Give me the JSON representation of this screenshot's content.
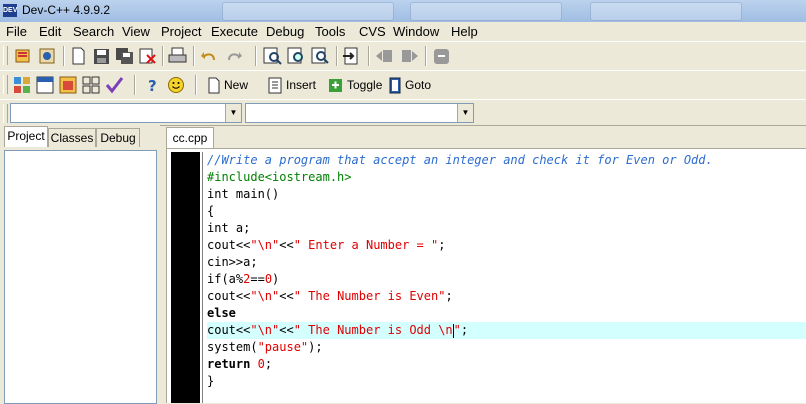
{
  "window": {
    "title": "Dev-C++ 4.9.9.2"
  },
  "menu": [
    "File",
    "Edit",
    "Search",
    "View",
    "Project",
    "Execute",
    "Debug",
    "Tools",
    "CVS",
    "Window",
    "Help"
  ],
  "toolbar2": {
    "new_label": "New",
    "insert_label": "Insert",
    "toggle_label": "Toggle",
    "goto_label": "Goto"
  },
  "combos": {
    "left_value": "",
    "right_value": ""
  },
  "left_panel": {
    "tabs": [
      "Project",
      "Classes",
      "Debug"
    ],
    "active_tab": "Project"
  },
  "editor": {
    "tab_label": "cc.cpp",
    "highlighted_line": 10,
    "lines": [
      [
        {
          "t": "//Write a program that accept an integer and check it for Even or Odd.",
          "c": "comment"
        }
      ],
      [
        {
          "t": "#include<iostream.h>",
          "c": "pre"
        }
      ],
      [
        {
          "t": "int main()",
          "c": ""
        }
      ],
      [
        {
          "t": "{",
          "c": ""
        }
      ],
      [
        {
          "t": "int a;",
          "c": ""
        }
      ],
      [
        {
          "t": "cout<<",
          "c": ""
        },
        {
          "t": "\"\\n\"",
          "c": "str"
        },
        {
          "t": "<<",
          "c": ""
        },
        {
          "t": "\" Enter a Number = \"",
          "c": "str"
        },
        {
          "t": ";",
          "c": ""
        }
      ],
      [
        {
          "t": "cin>>a;",
          "c": ""
        }
      ],
      [
        {
          "t": "if(a%",
          "c": ""
        },
        {
          "t": "2",
          "c": "num"
        },
        {
          "t": "==",
          "c": ""
        },
        {
          "t": "0",
          "c": "num"
        },
        {
          "t": ")",
          "c": ""
        }
      ],
      [
        {
          "t": "cout<<",
          "c": ""
        },
        {
          "t": "\"\\n\"",
          "c": "str"
        },
        {
          "t": "<<",
          "c": ""
        },
        {
          "t": "\" The Number is Even\"",
          "c": "str"
        },
        {
          "t": ";",
          "c": ""
        }
      ],
      [
        {
          "t": "else",
          "c": "bold"
        }
      ],
      [
        {
          "t": "cout<<",
          "c": ""
        },
        {
          "t": "\"\\n\"",
          "c": "str"
        },
        {
          "t": "<<",
          "c": ""
        },
        {
          "t": "\" The Number is Odd \\n",
          "c": "str"
        },
        {
          "t": "|caret|",
          "c": "caret"
        },
        {
          "t": "\"",
          "c": "str"
        },
        {
          "t": ";",
          "c": ""
        }
      ],
      [
        {
          "t": "system(",
          "c": ""
        },
        {
          "t": "\"pause\"",
          "c": "str"
        },
        {
          "t": ");",
          "c": ""
        }
      ],
      [
        {
          "t": "return ",
          "c": "bold"
        },
        {
          "t": "0",
          "c": "num"
        },
        {
          "t": ";",
          "c": ""
        }
      ],
      [
        {
          "t": "}",
          "c": ""
        }
      ]
    ]
  },
  "colors": {
    "comment": "#2c6cd0",
    "preprocessor": "#008000",
    "string": "#e00000",
    "highlight": "#d4ffff",
    "gutter": "#000000"
  }
}
